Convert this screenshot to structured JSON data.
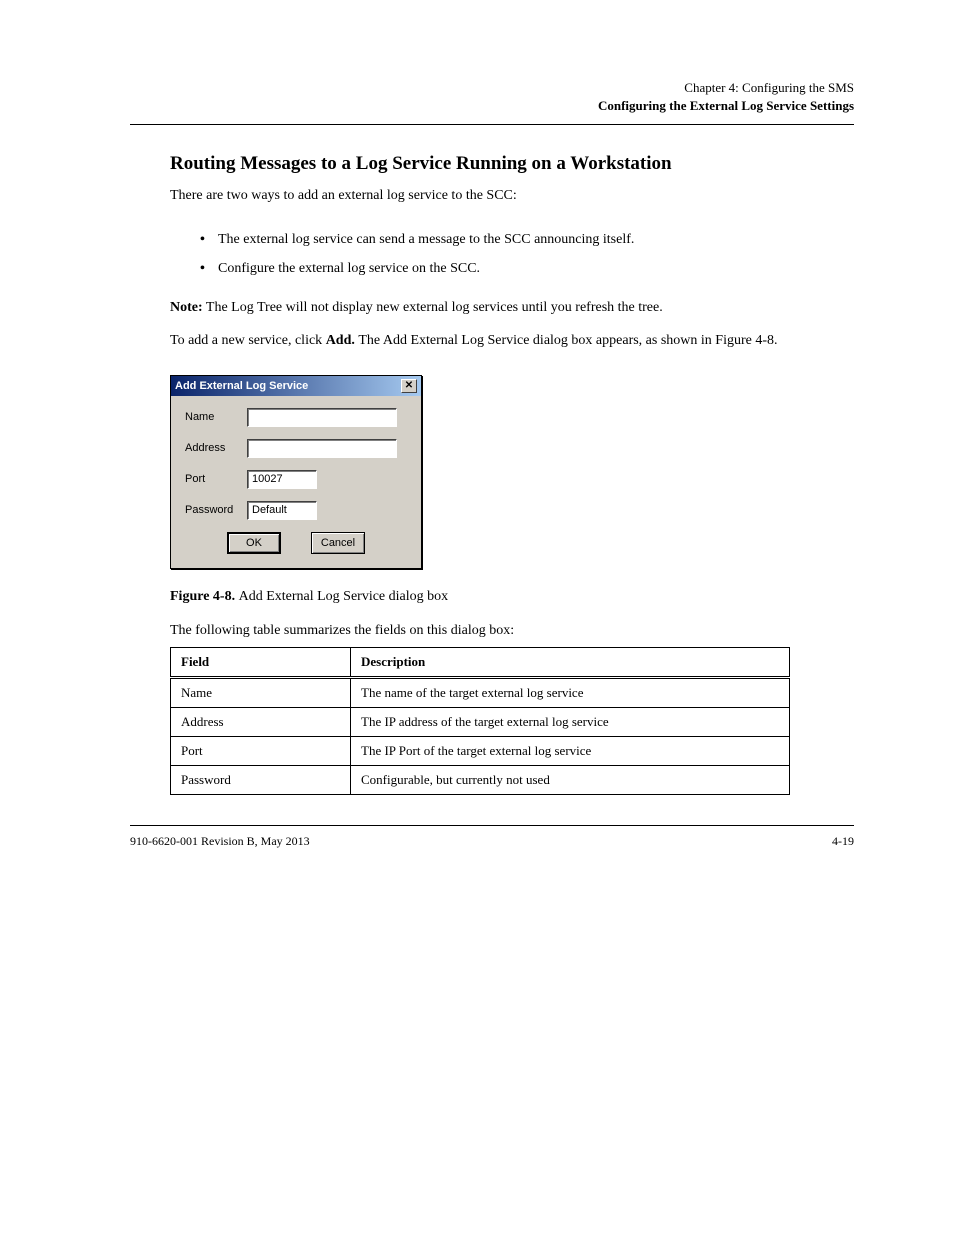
{
  "header": {
    "chapter": "Chapter 4: Configuring the SMS",
    "section_title": "Configuring the External Log Service Settings"
  },
  "paragraphs": {
    "p1_prefix": "To add a new service, click ",
    "p1_bold": "Add. ",
    "p1_suffix": "The Add External Log Service dialog box appears, as shown in Figure 4-8.",
    "p2": "The following table summarizes the fields on this dialog box:"
  },
  "section": {
    "heading": "Routing Messages to a Log Service Running on a Workstation",
    "intro": "There are two ways to add an external log service to the SCC:",
    "items": [
      "The external log service can send a message to the SCC announcing itself.",
      "Configure the external log service on the SCC."
    ],
    "note_prefix": "Note:",
    "note_body": " The Log Tree will not display new external log services until you refresh the tree."
  },
  "dialog": {
    "title": "Add External Log Service",
    "labels": {
      "name": "Name",
      "address": "Address",
      "port": "Port",
      "password": "Password"
    },
    "values": {
      "name": "",
      "address": "",
      "port": "10027",
      "password": "Default"
    },
    "buttons": {
      "ok": "OK",
      "cancel": "Cancel"
    }
  },
  "figure": {
    "number": "Figure 4-8. ",
    "caption": "Add External Log Service dialog box"
  },
  "table": {
    "headers": {
      "field": "Field",
      "description": "Description"
    },
    "rows": [
      {
        "field": "Name",
        "description": "The name of the target external log service"
      },
      {
        "field": "Address",
        "description": "The IP address of the target external log service"
      },
      {
        "field": "Port",
        "description": "The IP Port of the target external log service"
      },
      {
        "field": "Password",
        "description": "Configurable, but currently not used"
      }
    ]
  },
  "footer": {
    "left": "910-6620-001 Revision B, May 2013",
    "right": "4-19"
  }
}
